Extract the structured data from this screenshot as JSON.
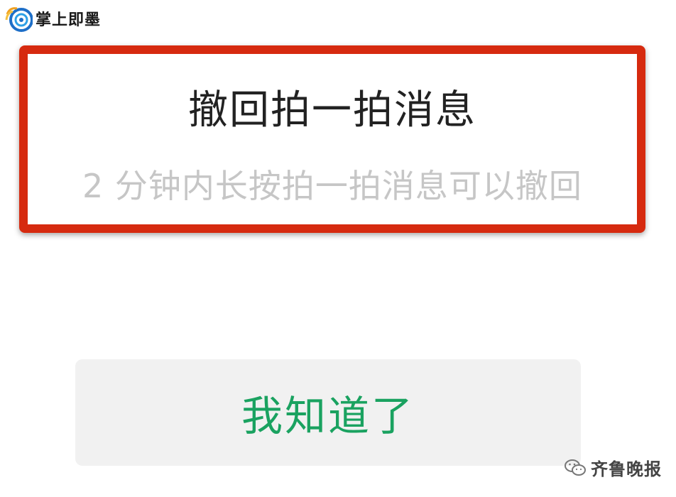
{
  "watermark_top": {
    "brand": "掌上即墨",
    "logo_icon": "swirl-logo-icon"
  },
  "dialog": {
    "title": "撤回拍一拍消息",
    "subtitle": "2 分钟内长按拍一拍消息可以撤回"
  },
  "confirm_button": {
    "label": "我知道了"
  },
  "watermark_bottom": {
    "source": "齐鲁晚报",
    "icon": "wechat-icon"
  },
  "colors": {
    "frame": "#d62a0f",
    "button_text": "#1aa260",
    "button_bg": "#f1f1f1",
    "subtitle": "#c6c6c6"
  }
}
